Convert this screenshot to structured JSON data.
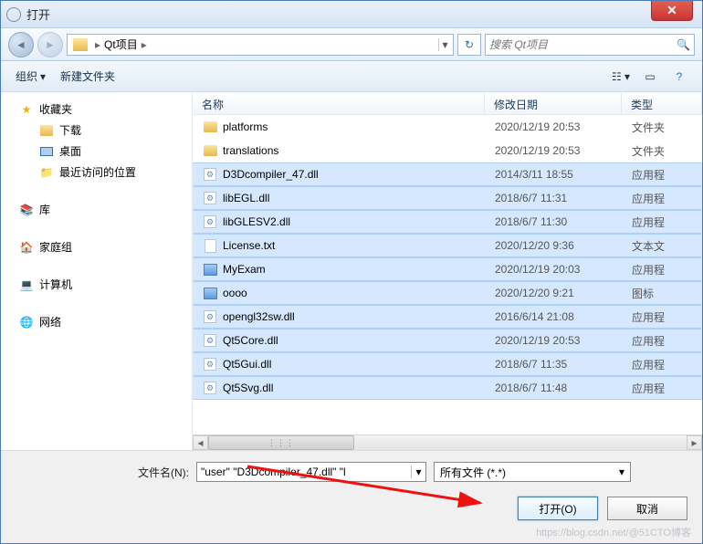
{
  "window": {
    "title": "打开"
  },
  "nav": {
    "breadcrumb": {
      "folder": "Qt项目"
    },
    "search_placeholder": "搜索 Qt项目"
  },
  "toolbar": {
    "organize": "组织",
    "new_folder": "新建文件夹"
  },
  "sidebar": {
    "favorites": {
      "label": "收藏夹",
      "items": [
        "下载",
        "桌面",
        "最近访问的位置"
      ]
    },
    "libraries": {
      "label": "库"
    },
    "homegroup": {
      "label": "家庭组"
    },
    "computer": {
      "label": "计算机"
    },
    "network": {
      "label": "网络"
    }
  },
  "columns": {
    "name": "名称",
    "date": "修改日期",
    "type": "类型"
  },
  "files": [
    {
      "name": "platforms",
      "date": "2020/12/19 20:53",
      "type": "文件夹",
      "icon": "folder",
      "selected": false
    },
    {
      "name": "translations",
      "date": "2020/12/19 20:53",
      "type": "文件夹",
      "icon": "folder",
      "selected": false
    },
    {
      "name": "D3Dcompiler_47.dll",
      "date": "2014/3/11 18:55",
      "type": "应用程",
      "icon": "dll",
      "selected": true
    },
    {
      "name": "libEGL.dll",
      "date": "2018/6/7 11:31",
      "type": "应用程",
      "icon": "dll",
      "selected": true
    },
    {
      "name": "libGLESV2.dll",
      "date": "2018/6/7 11:30",
      "type": "应用程",
      "icon": "dll",
      "selected": true
    },
    {
      "name": "License.txt",
      "date": "2020/12/20 9:36",
      "type": "文本文",
      "icon": "txt",
      "selected": true
    },
    {
      "name": "MyExam",
      "date": "2020/12/19 20:03",
      "type": "应用程",
      "icon": "exe",
      "selected": true
    },
    {
      "name": "oooo",
      "date": "2020/12/20 9:21",
      "type": "图标",
      "icon": "exe",
      "selected": true
    },
    {
      "name": "opengl32sw.dll",
      "date": "2016/6/14 21:08",
      "type": "应用程",
      "icon": "dll",
      "selected": true
    },
    {
      "name": "Qt5Core.dll",
      "date": "2020/12/19 20:53",
      "type": "应用程",
      "icon": "dll",
      "selected": true
    },
    {
      "name": "Qt5Gui.dll",
      "date": "2018/6/7 11:35",
      "type": "应用程",
      "icon": "dll",
      "selected": true
    },
    {
      "name": "Qt5Svg.dll",
      "date": "2018/6/7 11:48",
      "type": "应用程",
      "icon": "dll",
      "selected": true
    }
  ],
  "footer": {
    "filename_label": "文件名(N):",
    "filename_value": "\"user\" \"D3Dcompiler_47.dll\" \"l",
    "filter_label": "所有文件 (*.*)",
    "open_btn": "打开(O)",
    "cancel_btn": "取消"
  },
  "watermark": "https://blog.csdn.net/@51CTO博客"
}
